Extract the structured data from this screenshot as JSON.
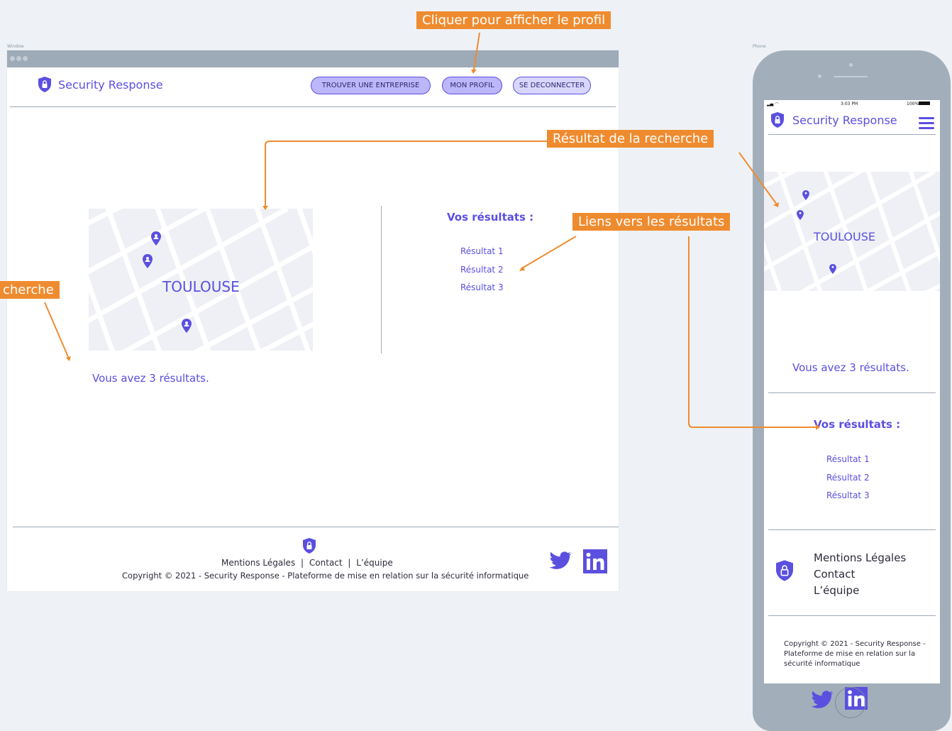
{
  "frames": {
    "window_label": "Window",
    "phone_label": "Phone"
  },
  "brand": {
    "name": "Security Response"
  },
  "nav": {
    "find_company": "TROUVER UNE ENTREPRISE",
    "my_profile": "MON PROFIL",
    "logout": "SE DECONNECTER"
  },
  "map": {
    "city": "TOULOUSE"
  },
  "results": {
    "summary": "Vous avez 3 résultats.",
    "heading": "Vos résultats :",
    "items": [
      "Résultat 1",
      "Résultat 2",
      "Résultat 3"
    ]
  },
  "footer": {
    "links": [
      "Mentions Légales",
      "Contact",
      "L’équipe"
    ],
    "separator": "|",
    "copyright": "Copyright © 2021 - Security Response - Plateforme de mise en relation sur la sécurité informatique"
  },
  "phone_status": {
    "time": "3:03 PM",
    "battery": "100%"
  },
  "annotations": {
    "profile": "Cliquer pour afficher le profil",
    "result": "Résultat de la recherche",
    "links": "Liens vers les résultats",
    "search": "cherche"
  },
  "colors": {
    "accent": "#5b4fe0",
    "annotation": "#ef8b2f",
    "frame": "#9daab7"
  },
  "icons": [
    "shield-lock-icon",
    "map-pin-icon",
    "twitter-icon",
    "linkedin-icon",
    "hamburger-menu-icon"
  ]
}
